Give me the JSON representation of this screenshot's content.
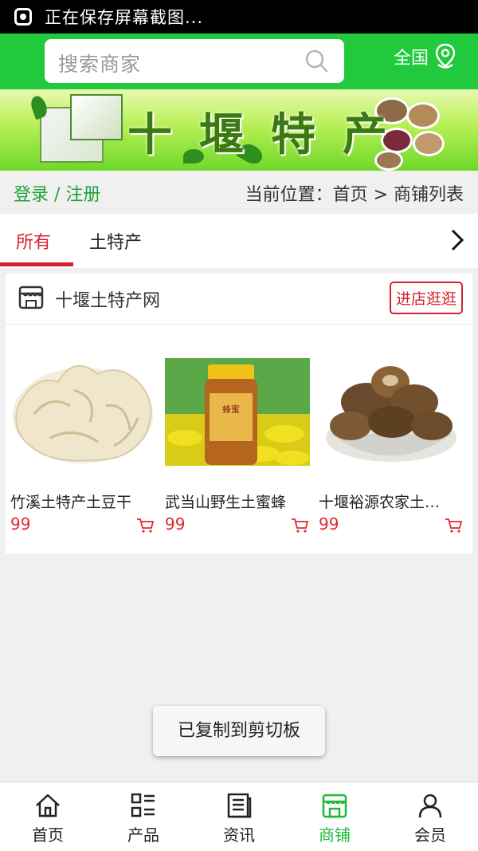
{
  "status_bar": {
    "text": "正在保存屏幕截图..."
  },
  "header": {
    "search_placeholder": "搜索商家",
    "region_label": "全国",
    "icons": {
      "search": "search-icon",
      "location": "location-pin-icon"
    }
  },
  "banner": {
    "title": "十堰特产"
  },
  "breadcrumb": {
    "login_register": "登录 / 注册",
    "location": "当前位置：首页 > 商铺列表"
  },
  "tabs": {
    "items": [
      {
        "label": "所有",
        "active": true
      },
      {
        "label": "土特产",
        "active": false
      }
    ],
    "more_icon": "chevron-right-icon"
  },
  "shop": {
    "name": "十堰土特产网",
    "visit_label": "进店逛逛",
    "products": [
      {
        "name": "竹溪土特产土豆干",
        "price": "99"
      },
      {
        "name": "武当山野生土蜜蜂",
        "price": "99"
      },
      {
        "name": "十堰裕源农家土…",
        "price": "99"
      }
    ]
  },
  "toast": {
    "text": "已复制到剪切板"
  },
  "bottom_nav": {
    "items": [
      {
        "label": "首页",
        "icon": "home-icon",
        "active": false
      },
      {
        "label": "产品",
        "icon": "product-list-icon",
        "active": false
      },
      {
        "label": "资讯",
        "icon": "news-icon",
        "active": false
      },
      {
        "label": "商铺",
        "icon": "shop-icon",
        "active": true
      },
      {
        "label": "会员",
        "icon": "member-icon",
        "active": false
      }
    ]
  },
  "colors": {
    "brand_green": "#21c93d",
    "accent_red": "#d4232b",
    "price_red": "#e2282f",
    "active_nav_green": "#21b93a"
  }
}
